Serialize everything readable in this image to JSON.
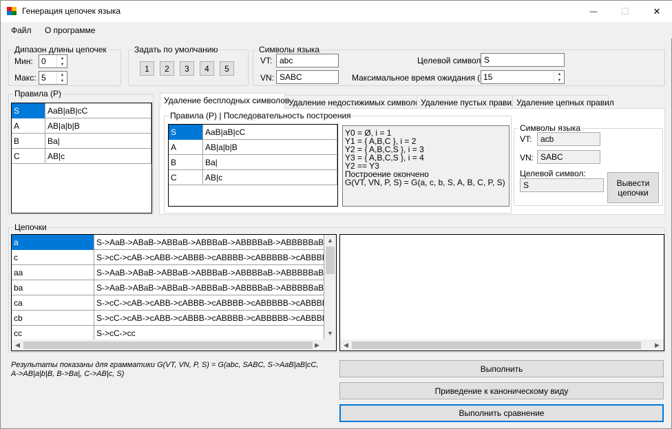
{
  "window": {
    "title": "Генерация цепочек языка",
    "minimize_glyph": "—",
    "maximize_glyph": "☐",
    "close_glyph": "✕"
  },
  "menu": [
    {
      "label": "Файл"
    },
    {
      "label": "О программе"
    }
  ],
  "length_range": {
    "title": "Дипазон длины цепочек",
    "min_label": "Мин:",
    "min_value": "0",
    "max_label": "Макс:",
    "max_value": "5"
  },
  "defaults": {
    "title": "Задать по умолчанию",
    "buttons": [
      "1",
      "2",
      "3",
      "4",
      "5"
    ]
  },
  "language_symbols": {
    "title": "Символы языка",
    "vt_label": "VT:",
    "vt_value": "abc",
    "vn_label": "VN:",
    "vn_value": "SABC",
    "target_label": "Целевой символ:",
    "target_value": "S",
    "timeout_label": "Максимальное время ожидания (с):",
    "timeout_value": "15"
  },
  "rules": {
    "title": "Правила (P)",
    "rows": [
      {
        "left": "S",
        "right": "AaB|aB|cC"
      },
      {
        "left": "A",
        "right": "AB|a|b|B"
      },
      {
        "left": "B",
        "right": "Ba|"
      },
      {
        "left": "C",
        "right": "AB|c"
      }
    ]
  },
  "tabs": [
    {
      "label": "Удаление бесплодных символов"
    },
    {
      "label": "Удаление недостижимых символов"
    },
    {
      "label": "Удаление пустых правил"
    },
    {
      "label": "Удаление цепных правил"
    }
  ],
  "tab_content": {
    "group_title": "Правила (P) | Последовательность построения",
    "rules": [
      {
        "left": "S",
        "right": "AaB|aB|cC"
      },
      {
        "left": "A",
        "right": "AB|a|b|B"
      },
      {
        "left": "B",
        "right": "Ba|"
      },
      {
        "left": "C",
        "right": "AB|c"
      }
    ],
    "log": [
      "Y0 = Ø, i = 1",
      "Y1 = { A,B,C }, i = 2",
      "Y2 = { A,B,C,S }, i = 3",
      "Y3 = { A,B,C,S }, i = 4",
      "Y2 == Y3",
      "Построение окончено",
      "G(VT, VN, P, S) = G(a, c, b, S, A, B, C, P, S)"
    ],
    "symbols_title": "Символы языка",
    "vt_label": "VT:",
    "vt_value": "acb",
    "vn_label": "VN:",
    "vn_value": "SABC",
    "target_label": "Целевой символ:",
    "target_value": "S",
    "output_button": "Вывести цепочки"
  },
  "chains": {
    "title": "Цепочки",
    "rows": [
      {
        "word": "a",
        "derivation": "S->AaB->ABaB->ABBaB->ABBBaB->ABBBBaB->ABBBBBaB->ABBBB"
      },
      {
        "word": "c",
        "derivation": "S->cC->cAB->cABB->cABBB->cABBBB->cABBBBB->cABBBBBB->cA"
      },
      {
        "word": "aa",
        "derivation": "S->AaB->ABaB->ABBaB->ABBBaB->ABBBBaB->ABBBBBaB->ABBBB"
      },
      {
        "word": "ba",
        "derivation": "S->AaB->ABaB->ABBaB->ABBBaB->ABBBBaB->ABBBBBaB->ABBBB"
      },
      {
        "word": "ca",
        "derivation": "S->cC->cAB->cABB->cABBB->cABBBB->cABBBBB->cABBBBBB->cA"
      },
      {
        "word": "cb",
        "derivation": "S->cC->cAB->cABB->cABBB->cABBBB->cABBBBB->cABBBBBB->cA"
      },
      {
        "word": "cc",
        "derivation": "S->cC->cc"
      }
    ]
  },
  "result_note": "Результаты показаны для грамматики G(VT, VN, P, S) = G(abc, SABC, S->AaB|aB|cC, A->AB|a|b|B, B->Ba|, C->AB|c, S)",
  "actions": {
    "execute": "Выполнить",
    "canonical": "Приведение к каноническому виду",
    "compare": "Выполнить сравнение"
  },
  "colors": {
    "selection": "#0078d7",
    "background": "#f0f0f0",
    "border": "#adadad"
  }
}
